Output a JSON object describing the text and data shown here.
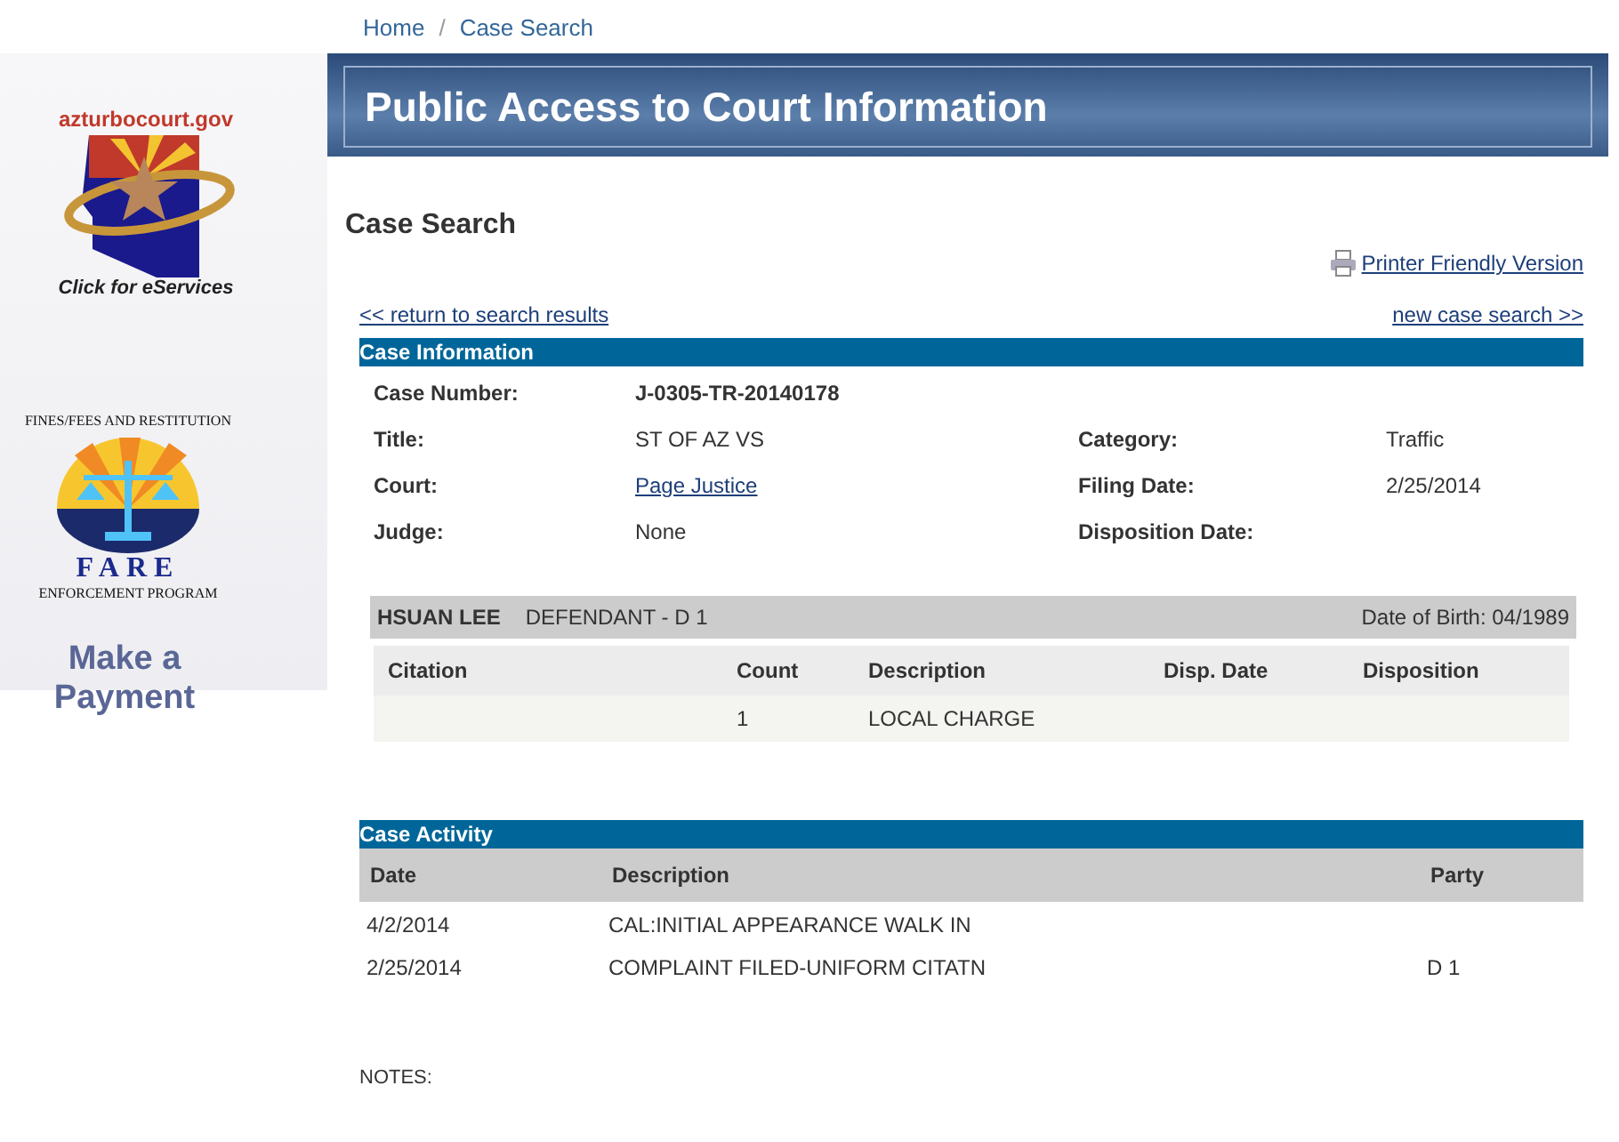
{
  "breadcrumb": [
    {
      "label": "Home"
    },
    {
      "label": "Case Search"
    }
  ],
  "breadcrumb_separator": "/",
  "sidebar": {
    "eservices_logo": {
      "site": "azturbocourt.gov",
      "caption": "Click for eServices"
    },
    "fare_logo": {
      "arc_text": "FINES/FEES AND RESTITUTION",
      "name": "FARE",
      "program": "ENFORCEMENT PROGRAM"
    },
    "payment_link": "Make a Payment"
  },
  "banner": {
    "title": "Public Access to Court Information"
  },
  "page_title": "Case Search",
  "printer_link": "Printer Friendly Version",
  "nav_links": {
    "back": "<< return to search results",
    "new": "new case search >>"
  },
  "case_information": {
    "heading": "Case Information",
    "fields": [
      {
        "label": "Case Number:",
        "value": "J-0305-TR-20140178",
        "kind": "bold"
      },
      {
        "label": "Title:",
        "value": "ST OF AZ VS",
        "kind": "text"
      },
      {
        "label": "Category:",
        "value": "Traffic",
        "kind": "text"
      },
      {
        "label": "Court:",
        "value": "Page Justice",
        "kind": "link"
      },
      {
        "label": "Filing Date:",
        "value": "2/25/2014",
        "kind": "text"
      },
      {
        "label": "Judge:",
        "value": "None",
        "kind": "text"
      },
      {
        "label": "Disposition Date:"
      }
    ]
  },
  "party": {
    "name": "HSUAN LEE",
    "role": "DEFENDANT  -  D 1",
    "birth": "Date of Birth: 04/1989",
    "columns": [
      "Citation",
      "Count",
      "Description",
      "Disp. Date",
      "Disposition"
    ],
    "rows": [
      [
        "",
        "1",
        "LOCAL CHARGE",
        "",
        ""
      ]
    ]
  },
  "case_activity": {
    "heading": "Case Activity",
    "columns": [
      "Date",
      "Description",
      "Party"
    ],
    "rows": [
      [
        "4/2/2014",
        "CAL:INITIAL APPEARANCE WALK IN",
        ""
      ],
      [
        "2/25/2014",
        "COMPLAINT FILED-UNIFORM CITATN",
        "D 1"
      ]
    ]
  },
  "notes_label": "NOTES:"
}
